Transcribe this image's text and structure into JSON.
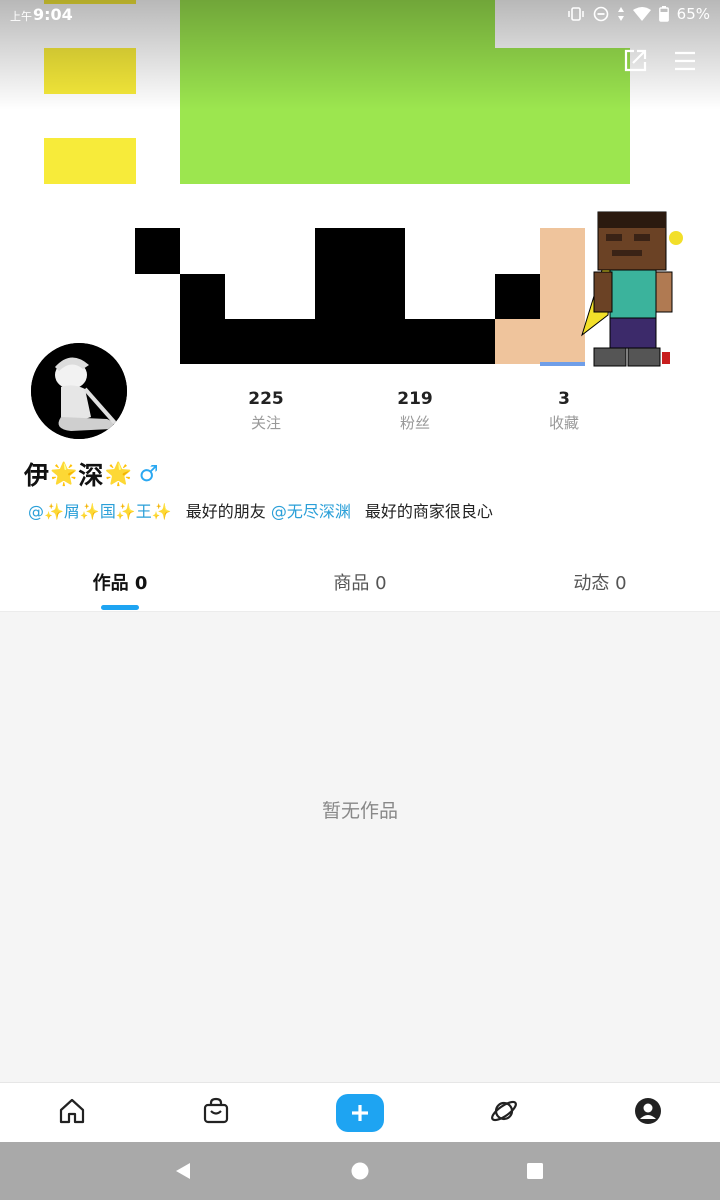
{
  "status_bar": {
    "ampm": "上午",
    "time": "9:04",
    "battery": "65%",
    "icons": [
      "vibrate-icon",
      "dnd-icon",
      "data-arrows-icon",
      "wifi-icon",
      "battery-icon"
    ]
  },
  "header": {
    "actions": [
      "share-icon",
      "menu-icon"
    ]
  },
  "profile": {
    "name_part1": "伊",
    "name_part2": "深",
    "name_emoji": "🌟",
    "gender_symbol": "♂",
    "stats": [
      {
        "value": "225",
        "label": "关注"
      },
      {
        "value": "219",
        "label": "粉丝"
      },
      {
        "value": "3",
        "label": "收藏"
      }
    ],
    "bio": {
      "mention1": "@✨屑✨国✨王✨",
      "text1": "最好的朋友",
      "mention2": "@无尽深渊",
      "text2": "最好的商家很良心"
    }
  },
  "tabs": [
    {
      "label": "作品 0",
      "active": true
    },
    {
      "label": "商品 0",
      "active": false
    },
    {
      "label": "动态 0",
      "active": false
    }
  ],
  "content": {
    "empty_text": "暂无作品"
  },
  "bottom_nav": {
    "items": [
      "home-icon",
      "shop-bag-icon",
      "create-plus-icon",
      "explore-planet-icon",
      "profile-icon"
    ],
    "accent": "#1ea4f2"
  },
  "system_nav": [
    "back-icon",
    "home-circle-icon",
    "recents-icon"
  ]
}
